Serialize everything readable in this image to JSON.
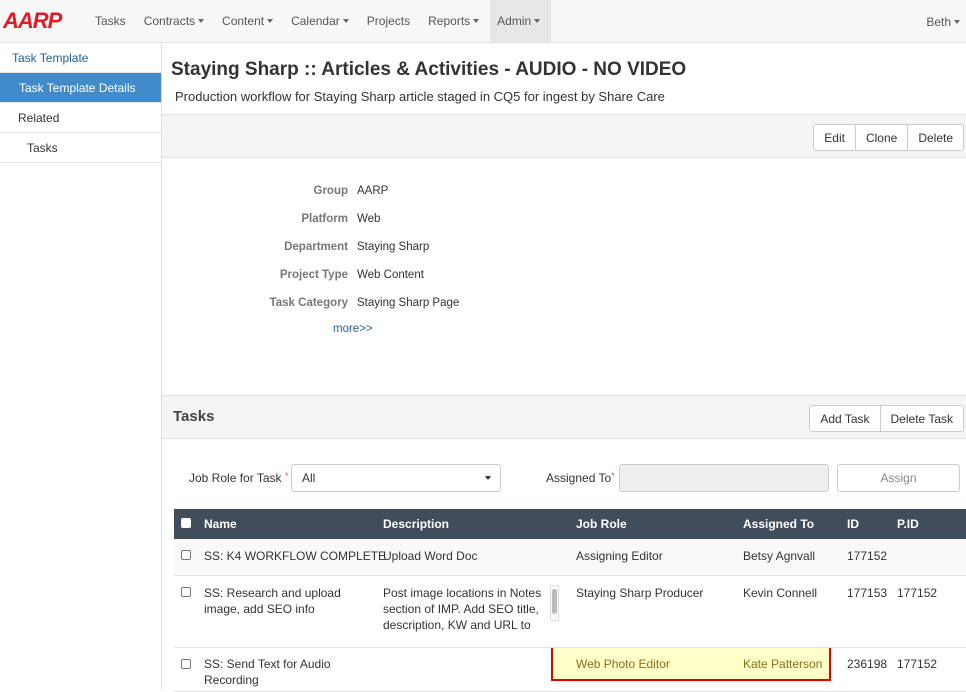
{
  "nav": {
    "brand": "AARP",
    "items": [
      {
        "label": "Tasks",
        "dropdown": false,
        "active": false
      },
      {
        "label": "Contracts",
        "dropdown": true,
        "active": false
      },
      {
        "label": "Content",
        "dropdown": true,
        "active": false
      },
      {
        "label": "Calendar",
        "dropdown": true,
        "active": false
      },
      {
        "label": "Projects",
        "dropdown": false,
        "active": false
      },
      {
        "label": "Reports",
        "dropdown": true,
        "active": false
      },
      {
        "label": "Admin",
        "dropdown": true,
        "active": true
      }
    ],
    "user": "Beth"
  },
  "sidebar": {
    "items": [
      {
        "label": "Task Template"
      },
      {
        "label": "Task Template Details"
      },
      {
        "label": "Related"
      },
      {
        "label": "Tasks"
      }
    ]
  },
  "header": {
    "title": "Staying Sharp :: Articles & Activities - AUDIO - NO VIDEO",
    "subtitle": "Production workflow for Staying Sharp article staged in CQ5 for ingest by Share Care"
  },
  "toolbar": {
    "edit": "Edit",
    "clone": "Clone",
    "delete": "Delete"
  },
  "details": {
    "fields": [
      {
        "label": "Group",
        "value": "AARP"
      },
      {
        "label": "Platform",
        "value": "Web"
      },
      {
        "label": "Department",
        "value": "Staying Sharp"
      },
      {
        "label": "Project Type",
        "value": "Web Content"
      },
      {
        "label": "Task Category",
        "value": "Staying Sharp Page"
      }
    ],
    "more": "more>>"
  },
  "tasks": {
    "title": "Tasks",
    "add_task": "Add Task",
    "delete_task": "Delete Task",
    "job_role_label": "Job Role for Task",
    "job_role_value": "All",
    "assigned_to_label": "Assigned To",
    "assign_button": "Assign",
    "columns": [
      "Name",
      "Description",
      "Job Role",
      "Assigned To",
      "ID",
      "P.ID"
    ],
    "rows": [
      {
        "name": "SS: K4 WORKFLOW COMPLETE",
        "description": "Upload Word Doc",
        "job_role": "Assigning Editor",
        "assigned_to": "Betsy Agnvall",
        "id": "177152",
        "pid": ""
      },
      {
        "name": "SS: Research and upload image, add SEO info",
        "description": "Post image locations in Notes section of IMP. Add SEO title, description, KW and URL to",
        "job_role": "Staying Sharp Producer",
        "assigned_to": "Kevin Connell",
        "id": "177153",
        "pid": "177152"
      },
      {
        "name": "SS: Send Text for Audio Recording",
        "description": "",
        "job_role": "Web Photo Editor",
        "assigned_to": "Kate Patterson",
        "id": "236198",
        "pid": "177152"
      }
    ]
  },
  "colors": {
    "accent": "#428bca",
    "brand": "#e11b22",
    "table_header": "#3f4e5a",
    "highlight_border": "#e00000",
    "highlight_fill": "#ffffc8"
  }
}
